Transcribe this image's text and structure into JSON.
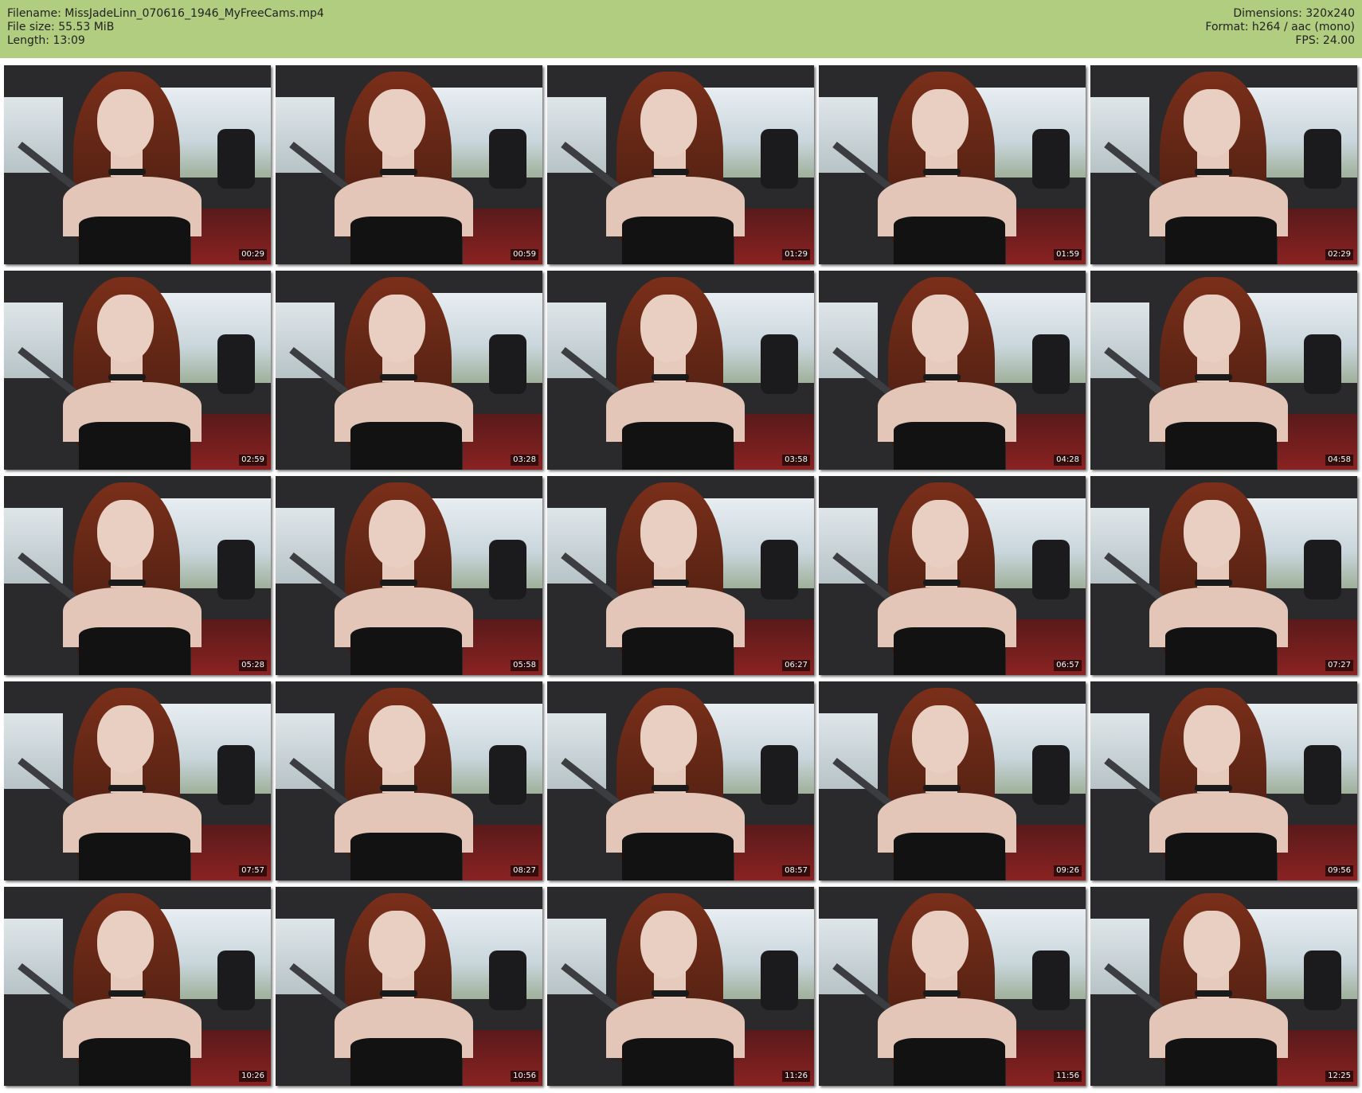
{
  "header": {
    "filename": "Filename: MissJadeLinn_070616_1946_MyFreeCams.mp4",
    "file_size": "File size: 55.53 MiB",
    "length": "Length: 13:09",
    "dimensions": "Dimensions: 320x240",
    "format": "Format: h264 / aac (mono)",
    "fps": "FPS: 24.00"
  },
  "thumbnails": [
    {
      "timestamp": "00:29"
    },
    {
      "timestamp": "00:59"
    },
    {
      "timestamp": "01:29"
    },
    {
      "timestamp": "01:59"
    },
    {
      "timestamp": "02:29"
    },
    {
      "timestamp": "02:59"
    },
    {
      "timestamp": "03:28"
    },
    {
      "timestamp": "03:58"
    },
    {
      "timestamp": "04:28"
    },
    {
      "timestamp": "04:58"
    },
    {
      "timestamp": "05:28"
    },
    {
      "timestamp": "05:58"
    },
    {
      "timestamp": "06:27"
    },
    {
      "timestamp": "06:57"
    },
    {
      "timestamp": "07:27"
    },
    {
      "timestamp": "07:57"
    },
    {
      "timestamp": "08:27"
    },
    {
      "timestamp": "08:57"
    },
    {
      "timestamp": "09:26"
    },
    {
      "timestamp": "09:56"
    },
    {
      "timestamp": "10:26"
    },
    {
      "timestamp": "10:56"
    },
    {
      "timestamp": "11:26"
    },
    {
      "timestamp": "11:56"
    },
    {
      "timestamp": "12:25"
    }
  ],
  "colors": {
    "header_bg": "#b0cd80",
    "timestamp_text": "#ffffff"
  }
}
